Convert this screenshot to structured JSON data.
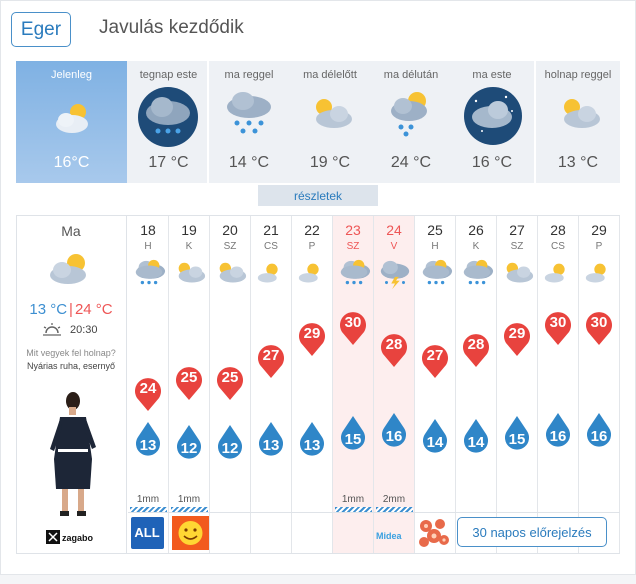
{
  "header": {
    "city": "Eger",
    "headline": "Javulás kezdődik"
  },
  "current": {
    "label": "Jelenleg",
    "temp": "16°C",
    "icon": "partly-cloudy-icon"
  },
  "slots": [
    {
      "label": "tegnap este",
      "temp": "17 °C",
      "icon": "night-rain-cloud-icon"
    },
    {
      "label": "ma reggel",
      "temp": "14 °C",
      "icon": "rain-cloud-icon"
    },
    {
      "label": "ma délelőtt",
      "temp": "19 °C",
      "icon": "partly-cloudy-icon"
    },
    {
      "label": "ma délután",
      "temp": "24 °C",
      "icon": "sun-cloud-rain-icon"
    },
    {
      "label": "ma este",
      "temp": "16 °C",
      "icon": "night-cloudy-icon"
    },
    {
      "label": "holnap reggel",
      "temp": "13 °C",
      "icon": "partly-cloudy-icon"
    }
  ],
  "details_label": "részletek",
  "today": {
    "label": "Ma",
    "min": "13 °C",
    "max": "24 °C",
    "sunset": "20:30",
    "question": "Mit vegyek fel holnap?",
    "answer": "Nyárias ruha, esernyő",
    "brand": "zagabo"
  },
  "days": [
    {
      "day": "18",
      "dow": "H",
      "max": "24",
      "min": "13",
      "rain": "1mm",
      "weekend": false
    },
    {
      "day": "19",
      "dow": "K",
      "max": "25",
      "min": "12",
      "rain": "1mm",
      "weekend": false
    },
    {
      "day": "20",
      "dow": "SZ",
      "max": "25",
      "min": "12",
      "rain": "",
      "weekend": false
    },
    {
      "day": "21",
      "dow": "CS",
      "max": "27",
      "min": "13",
      "rain": "",
      "weekend": false
    },
    {
      "day": "22",
      "dow": "P",
      "max": "29",
      "min": "13",
      "rain": "",
      "weekend": false
    },
    {
      "day": "23",
      "dow": "SZ",
      "max": "30",
      "min": "15",
      "rain": "1mm",
      "weekend": true
    },
    {
      "day": "24",
      "dow": "V",
      "max": "28",
      "min": "16",
      "rain": "2mm",
      "weekend": true
    },
    {
      "day": "25",
      "dow": "H",
      "max": "27",
      "min": "14",
      "rain": "",
      "weekend": false
    },
    {
      "day": "26",
      "dow": "K",
      "max": "28",
      "min": "14",
      "rain": "",
      "weekend": false
    },
    {
      "day": "27",
      "dow": "SZ",
      "max": "29",
      "min": "15",
      "rain": "",
      "weekend": false
    },
    {
      "day": "28",
      "dow": "CS",
      "max": "30",
      "min": "16",
      "rain": "",
      "weekend": false
    },
    {
      "day": "29",
      "dow": "P",
      "max": "30",
      "min": "16",
      "rain": "",
      "weekend": false
    }
  ],
  "sponsor": {
    "midea": "Midea"
  },
  "forecast_button": "30 napos előrejelzés",
  "colors": {
    "accent": "#2a7bbd",
    "max_pin": "#e8433e",
    "min_drop": "#2f86c8"
  }
}
